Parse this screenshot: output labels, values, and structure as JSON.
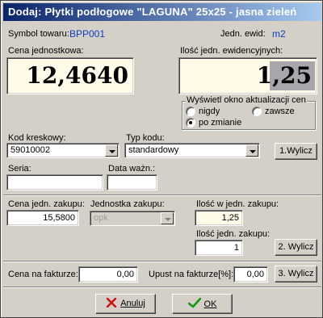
{
  "window": {
    "title": "Dodaj: Płytki podłogowe \"LAGUNA\" 25x25 - jasna zieleń"
  },
  "header": {
    "symbol_label": "Symbol towaru:",
    "symbol_value": "BPP001",
    "unit_label": "Jedn. ewid:",
    "unit_value": "m2"
  },
  "price": {
    "unit_price_label": "Cena jednostkowa:",
    "unit_price_value": "12,4640",
    "qty_label": "Ilość jedn. ewidencyjnych:",
    "qty_value": "1,25"
  },
  "update_window": {
    "legend": "Wyświetl okno aktualizacji cen",
    "options": [
      "nigdy",
      "zawsze",
      "po zmianie"
    ],
    "selected": "po zmianie"
  },
  "barcode": {
    "label": "Kod kreskowy:",
    "value": "59010002",
    "type_label": "Typ kodu:",
    "type_value": "standardowy",
    "calc_button": "1.Wylicz"
  },
  "batch": {
    "series_label": "Seria:",
    "series_value": "",
    "expiry_label": "Data ważn.:",
    "expiry_value": ""
  },
  "purchase": {
    "price_label": "Cena jedn. zakupu:",
    "price_value": "15,5800",
    "unit_label": "Jednostka zakupu:",
    "unit_value": "opk",
    "qty_in_unit_label": "Ilość w jedn. zakupu:",
    "qty_in_unit_value": "1,25",
    "qty_units_label": "Ilość jedn. zakupu:",
    "qty_units_value": "1",
    "calc_button": "2. Wylicz"
  },
  "invoice": {
    "price_label": "Cena na fakturze:",
    "price_value": "0,00",
    "discount_label": "Upust na fakturze[%]:",
    "discount_value": "0,00",
    "calc_button": "3. Wylicz"
  },
  "footer": {
    "cancel_label": "Anuluj",
    "ok_label": "OK"
  },
  "colors": {
    "titlebar_start": "#0a246a",
    "titlebar_end": "#a6caf0",
    "face": "#d4d0c8",
    "highlight_field": "#fffbe8",
    "accent_text": "#0b3fbe"
  }
}
